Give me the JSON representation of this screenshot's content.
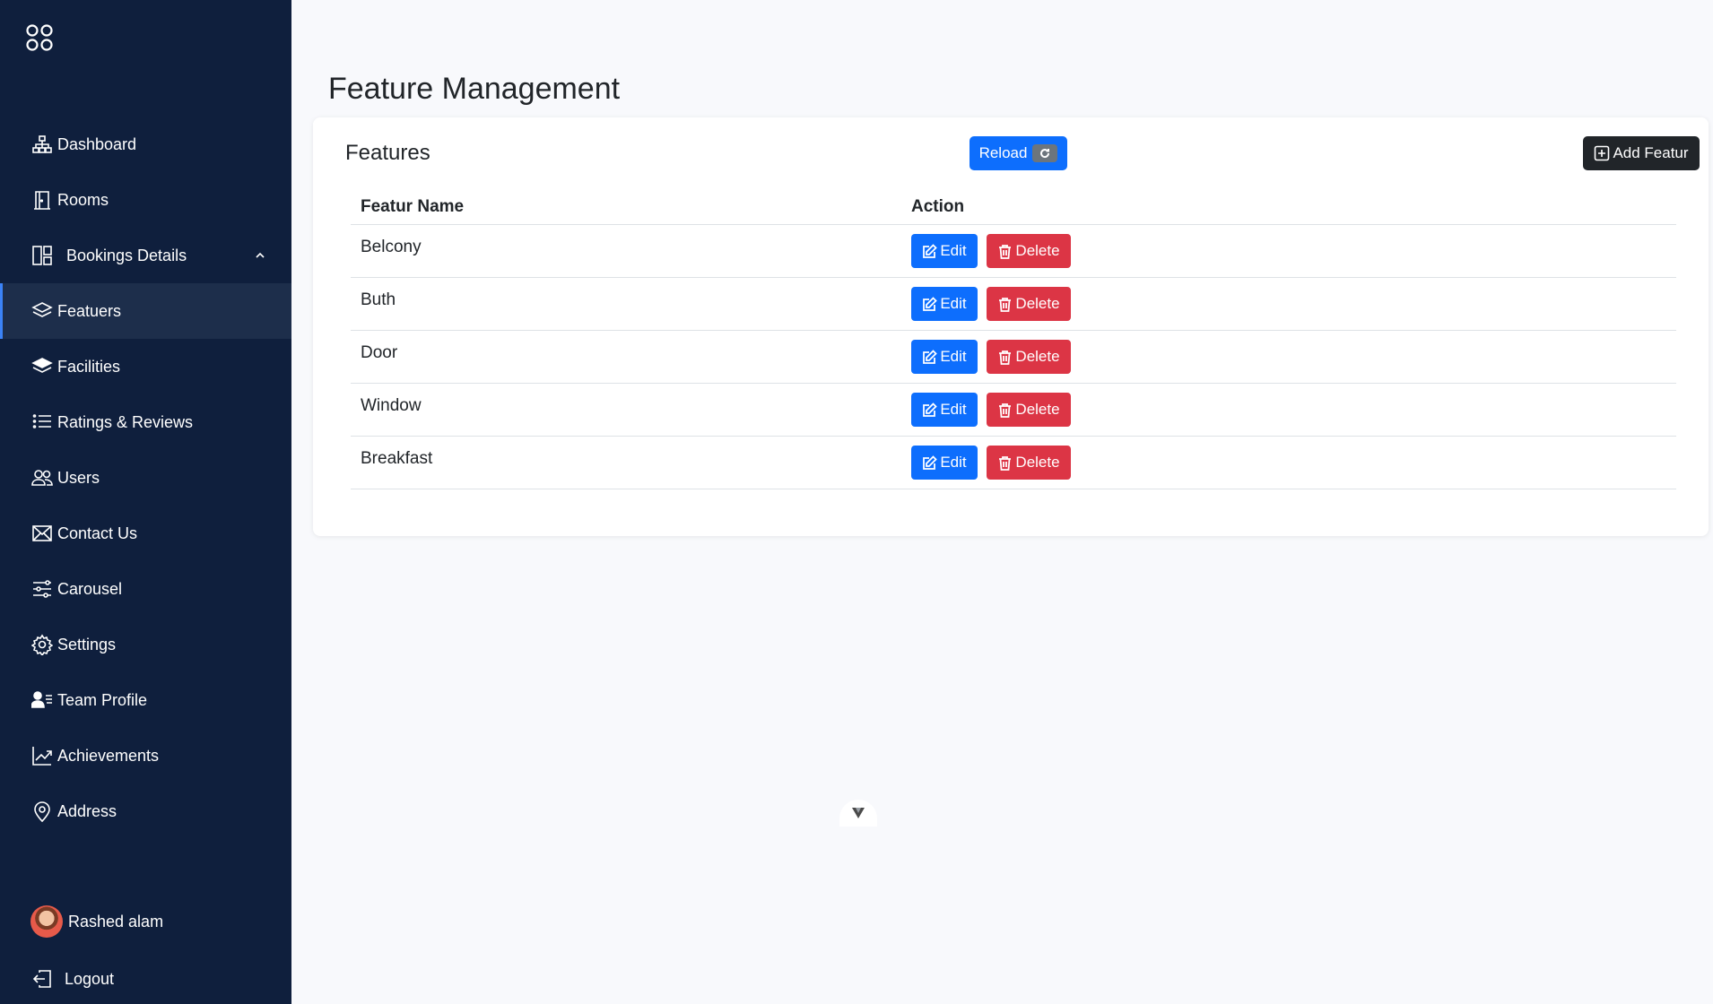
{
  "sidebar": {
    "items": [
      {
        "label": "Dashboard",
        "icon": "diagram-icon"
      },
      {
        "label": "Rooms",
        "icon": "door-icon"
      },
      {
        "label": "Bookings Details",
        "icon": "layout-icon"
      },
      {
        "label": "Featuers",
        "icon": "layers-icon"
      },
      {
        "label": "Facilities",
        "icon": "layers-filled-icon"
      },
      {
        "label": "Ratings & Reviews",
        "icon": "list-icon"
      },
      {
        "label": "Users",
        "icon": "people-icon"
      },
      {
        "label": "Contact Us",
        "icon": "envelope-icon"
      },
      {
        "label": "Carousel",
        "icon": "sliders-icon"
      },
      {
        "label": "Settings",
        "icon": "gear-icon"
      },
      {
        "label": "Team Profile",
        "icon": "person-lines-icon"
      },
      {
        "label": "Achievements",
        "icon": "graph-up-icon"
      },
      {
        "label": "Address",
        "icon": "geo-alt-icon"
      }
    ],
    "active_item": "Featuers",
    "user_name": "Rashed alam",
    "logout_label": "Logout"
  },
  "main": {
    "page_title": "Feature Management",
    "card_title": "Features",
    "reload_label": "Reload",
    "add_label": "Add Featur",
    "table": {
      "headers": [
        "Featur Name",
        "Action"
      ],
      "rows": [
        {
          "name": "Belcony"
        },
        {
          "name": "Buth"
        },
        {
          "name": "Door"
        },
        {
          "name": "Window"
        },
        {
          "name": "Breakfast"
        }
      ],
      "edit_label": "Edit",
      "delete_label": "Delete"
    }
  },
  "colors": {
    "sidebar_bg": "#0f1f3d",
    "primary": "#0d6efd",
    "danger": "#dc3545",
    "dark": "#212529"
  }
}
